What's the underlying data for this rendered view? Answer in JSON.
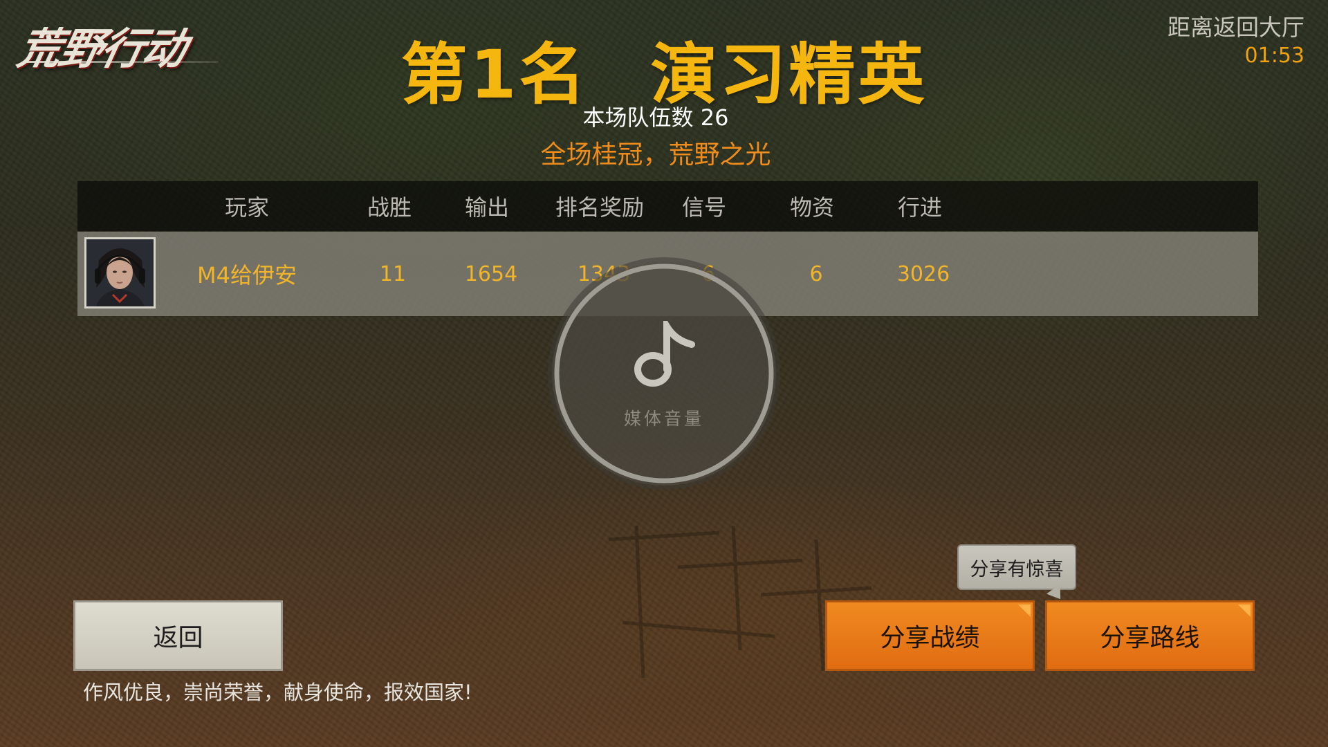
{
  "logo": {
    "text": "荒野行动"
  },
  "timer": {
    "label": "距离返回大厅",
    "value": "01:53"
  },
  "result": {
    "rank": "第1名",
    "title": "演习精英",
    "team_count": "本场队伍数 26",
    "slogan": "全场桂冠，荒野之光"
  },
  "table": {
    "headers": [
      "玩家",
      "战胜",
      "输出",
      "排名奖励",
      "信号",
      "物资",
      "行进"
    ],
    "row": {
      "player": "M4给伊安",
      "kills": "11",
      "damage": "1654",
      "rank_reward": "1343",
      "signal": "6",
      "supplies": "6",
      "travel": "3026"
    }
  },
  "volume_overlay": {
    "label": "媒体音量",
    "icon": "music-note-icon"
  },
  "buttons": {
    "back": "返回",
    "share_record": "分享战绩",
    "share_route": "分享路线"
  },
  "tooltip": {
    "text": "分享有惊喜"
  },
  "motto": "作风优良，崇尚荣誉，献身使命，报效国家!",
  "colors": {
    "title_gold": "#f5b70f",
    "slogan_orange": "#ef8c1c",
    "button_orange": "#e97a18",
    "timer_orange": "#f2a20f"
  }
}
